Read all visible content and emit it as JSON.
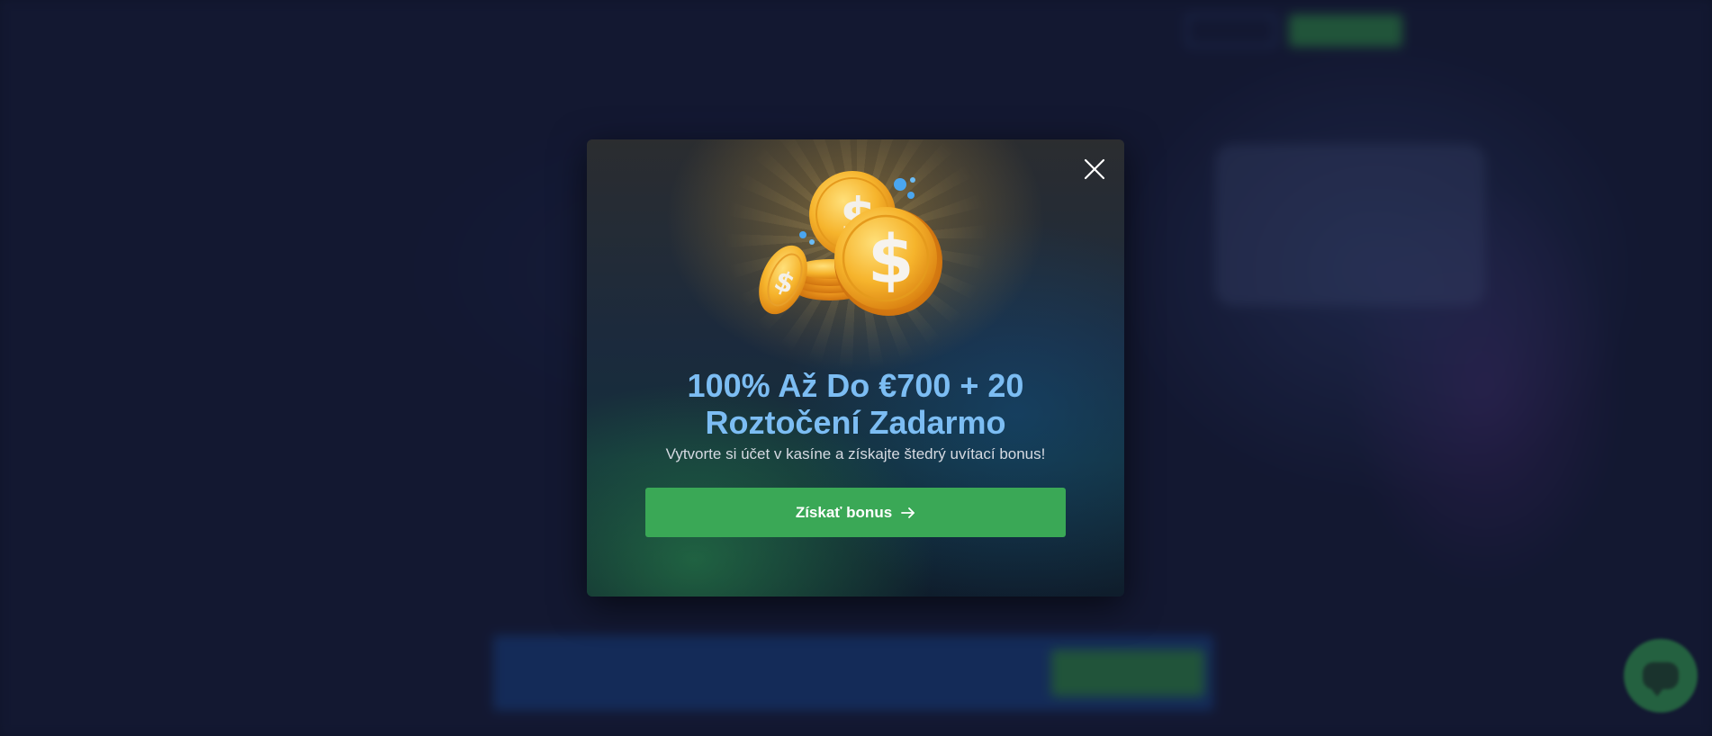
{
  "modal": {
    "title_line1": "100% Až Do €700 + 20",
    "title_line2": "Roztočení Zadarmo",
    "subtitle": "Vytvorte si účet v kasíne a získajte štedrý uvítací bonus!",
    "cta_label": "Získať bonus",
    "close_icon": "close-icon",
    "illustration_icon": "gold-coins-icon",
    "cta_arrow_icon": "arrow-right-icon"
  },
  "colors": {
    "title": "#7cbdf3",
    "cta": "#3aa856",
    "page_bg": "#141a33"
  },
  "chat": {
    "icon": "chat-bubble-icon"
  }
}
